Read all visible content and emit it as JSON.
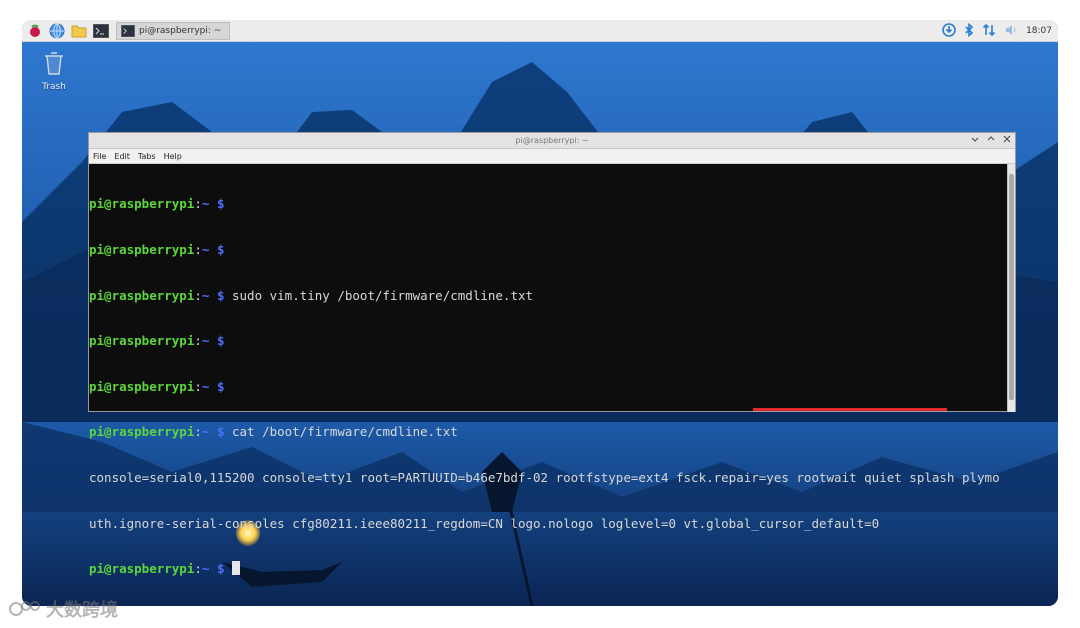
{
  "panel": {
    "task_label": "pi@raspberrypi: ~",
    "clock": "18:07"
  },
  "desktop": {
    "trash_label": "Trash"
  },
  "terminal": {
    "title": "pi@raspberrypi: ~",
    "menu": [
      "File",
      "Edit",
      "Tabs",
      "Help"
    ],
    "prompt_user": "pi@raspberrypi",
    "prompt_path": "~ $",
    "lines": [
      {
        "type": "prompt",
        "cmd": ""
      },
      {
        "type": "prompt",
        "cmd": ""
      },
      {
        "type": "prompt",
        "cmd": " sudo vim.tiny /boot/firmware/cmdline.txt"
      },
      {
        "type": "prompt",
        "cmd": ""
      },
      {
        "type": "prompt",
        "cmd": ""
      },
      {
        "type": "prompt",
        "cmd": " cat /boot/firmware/cmdline.txt"
      },
      {
        "type": "output",
        "text": "console=serial0,115200 console=tty1 root=PARTUUID=b46e7bdf-02 rootfstype=ext4 fsck.repair=yes rootwait quiet splash plymo"
      },
      {
        "type": "output",
        "text": "uth.ignore-serial-consoles cfg80211.ieee80211_regdom=CN logo.nologo loglevel=0 vt.global_cursor_default=0"
      },
      {
        "type": "prompt",
        "cmd": " ",
        "cursor": true
      }
    ]
  },
  "watermark": "大数跨境",
  "colors": {
    "prompt_green": "#5cd63a",
    "path_blue": "#4f6fff",
    "highlight_red": "#e32a2a"
  }
}
